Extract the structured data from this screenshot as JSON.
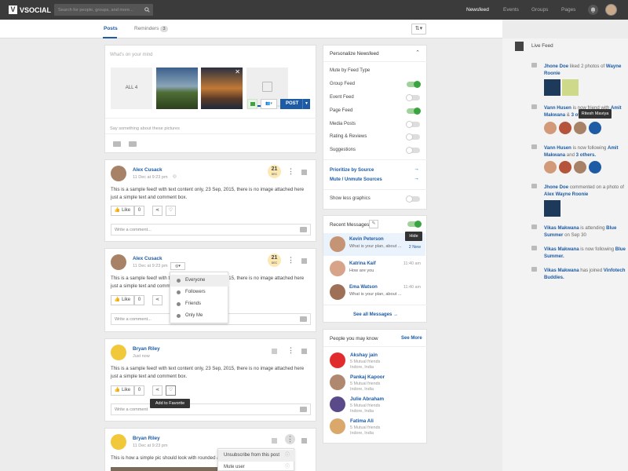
{
  "app": {
    "logo_letter": "V",
    "logo_text": "VSOCIAL"
  },
  "search": {
    "placeholder": "Search for people, groups, and more..."
  },
  "nav": [
    "Newsfeed",
    "Events",
    "Groups",
    "Pages"
  ],
  "tabs": {
    "posts": "Posts",
    "reminders": "Reminders",
    "reminders_count": "3"
  },
  "composer": {
    "placeholder": "What's on your mind",
    "all_label": "ALL 4",
    "say_placeholder": "Say something about these pictures",
    "post_label": "POST"
  },
  "posts": [
    {
      "author": "Alex Cusack",
      "meta": "11 Dec at 9:23 pm",
      "day": "21",
      "month": "DEC",
      "text": "This is a sample feed! with text content only,  23 Sep, 2015, there is no image attached here just a simple text and comment box.",
      "like": "Like",
      "likes": "0",
      "comment_placeholder": "Write a comment..."
    },
    {
      "author": "Alex Cusack",
      "meta": "11 Dec at 9:23 pm",
      "day": "21",
      "month": "DEC",
      "text": "This is a sample feed! with text content only,  23 Sep, 2015, there is no image attached here just a simple text and comment box.",
      "like": "Like",
      "likes": "0",
      "comment_placeholder": "Write a comment..."
    },
    {
      "author": "Bryan Riley",
      "meta": "Just now",
      "text": "This is a sample feed! with text content only,  23 Sep, 2015, there is no image attached here just a simple text and comment box.",
      "like": "Like",
      "likes": "0",
      "comment_placeholder": "Write a comment",
      "tooltip": "Add to Favorite"
    },
    {
      "author": "Bryan Riley",
      "meta": "11 Dec at 9:23 pm",
      "text": "This is how a simple pic should look with rounded a"
    }
  ],
  "privacy_menu": [
    "Everyone",
    "Followers",
    "Friends",
    "Only Me"
  ],
  "post_menu": [
    "Unsubscribe from  this post",
    "Mute user"
  ],
  "personalize": {
    "title": "Personalize Newsfeed",
    "mute_heading": "Mute by Feed Type",
    "feed_types": [
      {
        "label": "Group Feed",
        "on": true
      },
      {
        "label": "Event Feed",
        "on": false
      },
      {
        "label": "Page Feed",
        "on": true
      },
      {
        "label": "Media Posts",
        "on": false
      },
      {
        "label": "Rating & Reviews",
        "on": false
      },
      {
        "label": "Suggestions",
        "on": false
      }
    ],
    "prioritize": "Prioritize by Source",
    "mute_sources": "Mute / Unmute Sources",
    "less_graphics": "Show less graphics"
  },
  "messages": {
    "title": "Recent Messages",
    "hide_tooltip": "Hide",
    "items": [
      {
        "name": "Kevin Peterson",
        "text": "What is your plan, about ...",
        "time": "11:40 am",
        "new": "2 New"
      },
      {
        "name": "Katrina Kaif",
        "text": "How are you",
        "time": "11:40 am"
      },
      {
        "name": "Ema Watson",
        "text": "What is your plan, about ...",
        "time": "11:40 am"
      }
    ],
    "see_all": "See all Messages"
  },
  "people": {
    "title": "People you may know",
    "see_more": "See More",
    "items": [
      {
        "name": "Akshay jain",
        "mutual": "5 Mutual friends",
        "loc": "Indore, India"
      },
      {
        "name": "Pankaj Kapoor",
        "mutual": "5 Mutual friends",
        "loc": "Indore, India"
      },
      {
        "name": "Julie Abraham",
        "mutual": "5 Mutual friends",
        "loc": "Indore, India"
      },
      {
        "name": "Fatima Ali",
        "mutual": "5 Mutual friends",
        "loc": "Indore, India"
      }
    ]
  },
  "live_feed": {
    "title": "Live Feed",
    "tooltip": "Ritesh Maviya",
    "items": [
      {
        "a": "Jhone Doe",
        "b": " liked 2 photos of ",
        "c": "Wayne Roonie"
      },
      {
        "a": "Vann Husen",
        "b": " is now friend with ",
        "c": "Amit Makwana",
        "d": " & ",
        "e": "3 others."
      },
      {
        "a": "Vann Husen",
        "b": " is now following ",
        "c": "Amit Makwana",
        "d": " and ",
        "e": "3 others."
      },
      {
        "a": "Jhone Doe",
        "b": " commented on a photo of ",
        "c": "Alex Wayne Roonie"
      },
      {
        "a": "Vikas Makwana",
        "b": " is attending ",
        "c": "Blue Summer",
        "d": " on Sep 30"
      },
      {
        "a": "Vikas Makwana",
        "b": " is now following ",
        "c": "Blue Summer."
      },
      {
        "a": "Vikas Makwana",
        "b": " has joined ",
        "c": "Vinfotech Buddies."
      }
    ]
  },
  "colors": {
    "brand": "#1d5ba4",
    "topbar": "#3b3b3b",
    "toggle_on": "#3aa440"
  }
}
